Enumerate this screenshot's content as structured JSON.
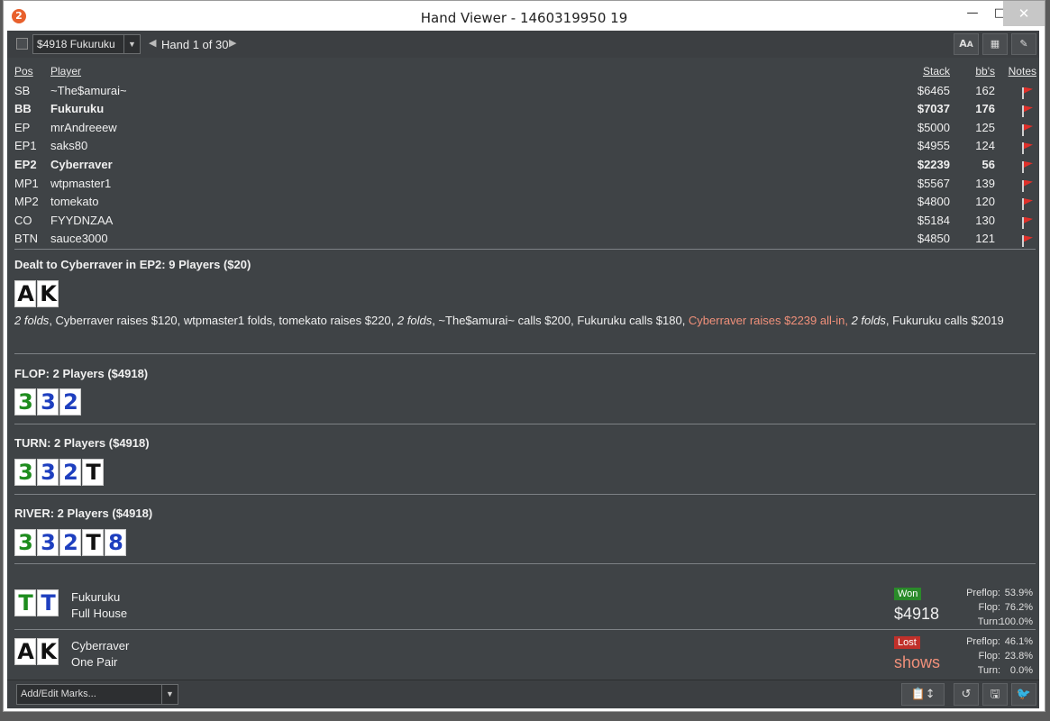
{
  "window": {
    "title": "Hand Viewer - 1460319950 19",
    "minimize_icon": "minimize-icon",
    "maximize_icon": "maximize-icon",
    "close_icon": "close-icon"
  },
  "toolbar": {
    "hand_select_value": "$4918 Fukuruku",
    "hand_counter": "Hand 1 of 30"
  },
  "players": {
    "headers": {
      "pos": "Pos",
      "player": "Player",
      "stack": "Stack",
      "bbs": "bb's",
      "notes": "Notes"
    },
    "rows": [
      {
        "pos": "SB",
        "name": "~The$amurai~",
        "stack": "$6465",
        "bbs": "162",
        "bold": false
      },
      {
        "pos": "BB",
        "name": "Fukuruku",
        "stack": "$7037",
        "bbs": "176",
        "bold": true
      },
      {
        "pos": "EP",
        "name": "mrAndreeew",
        "stack": "$5000",
        "bbs": "125",
        "bold": false
      },
      {
        "pos": "EP1",
        "name": "saks80",
        "stack": "$4955",
        "bbs": "124",
        "bold": false
      },
      {
        "pos": "EP2",
        "name": "Cyberraver",
        "stack": "$2239",
        "bbs": "56",
        "bold": true
      },
      {
        "pos": "MP1",
        "name": "wtpmaster1",
        "stack": "$5567",
        "bbs": "139",
        "bold": false
      },
      {
        "pos": "MP2",
        "name": "tomekato",
        "stack": "$4800",
        "bbs": "120",
        "bold": false
      },
      {
        "pos": "CO",
        "name": "FYYDNZAA",
        "stack": "$5184",
        "bbs": "130",
        "bold": false
      },
      {
        "pos": "BTN",
        "name": "sauce3000",
        "stack": "$4850",
        "bbs": "121",
        "bold": false
      }
    ]
  },
  "preflop": {
    "title": "Dealt to Cyberraver in EP2: 9 Players ($20)",
    "hole_cards": [
      {
        "rank": "A",
        "suit": "s"
      },
      {
        "rank": "K",
        "suit": "s"
      }
    ],
    "actions": {
      "a1": "2 folds",
      "a2": ", Cyberraver raises $120, wtpmaster1 folds, tomekato raises $220, ",
      "a3": "2 folds",
      "a4": ", ~The$amurai~ calls $200, Fukuruku calls $180, ",
      "a5": "Cyberraver raises $2239 all-in,",
      "a6": " ",
      "a7": "2 folds",
      "a8": ", Fukuruku calls $2019"
    }
  },
  "flop": {
    "title": "FLOP: 2 Players ($4918)",
    "cards": [
      {
        "rank": "3",
        "suit": "c"
      },
      {
        "rank": "3",
        "suit": "d"
      },
      {
        "rank": "2",
        "suit": "d"
      }
    ]
  },
  "turn": {
    "title": "TURN: 2 Players ($4918)",
    "cards": [
      {
        "rank": "3",
        "suit": "c"
      },
      {
        "rank": "3",
        "suit": "d"
      },
      {
        "rank": "2",
        "suit": "d"
      },
      {
        "rank": "T",
        "suit": "s"
      }
    ]
  },
  "river": {
    "title": "RIVER: 2 Players ($4918)",
    "cards": [
      {
        "rank": "3",
        "suit": "c"
      },
      {
        "rank": "3",
        "suit": "d"
      },
      {
        "rank": "2",
        "suit": "d"
      },
      {
        "rank": "T",
        "suit": "s"
      },
      {
        "rank": "8",
        "suit": "d"
      }
    ]
  },
  "results": [
    {
      "player": "Fukuruku",
      "hand": "Full House",
      "cards": [
        {
          "rank": "T",
          "suit": "c"
        },
        {
          "rank": "T",
          "suit": "d"
        }
      ],
      "badge": "Won",
      "amount": "$4918",
      "equity": {
        "preflop_label": "Preflop:",
        "preflop": "53.9%",
        "flop_label": "Flop:",
        "flop": "76.2%",
        "turn_label": "Turn:",
        "turn": "100.0%"
      }
    },
    {
      "player": "Cyberraver",
      "hand": "One Pair",
      "cards": [
        {
          "rank": "A",
          "suit": "s"
        },
        {
          "rank": "K",
          "suit": "s"
        }
      ],
      "badge": "Lost",
      "amount": "shows",
      "equity": {
        "preflop_label": "Preflop:",
        "preflop": "46.1%",
        "flop_label": "Flop:",
        "flop": "23.8%",
        "turn_label": "Turn:",
        "turn": "0.0%"
      }
    }
  ],
  "footer": {
    "marks_value": "Add/Edit Marks..."
  },
  "colors": {
    "spade": "#111111",
    "club": "#1e8c1e",
    "diamond": "#1e3fbf",
    "highlight_action": "#f0907a",
    "won_badge": "#2a8a2a",
    "lost_badge": "#c0302a"
  }
}
